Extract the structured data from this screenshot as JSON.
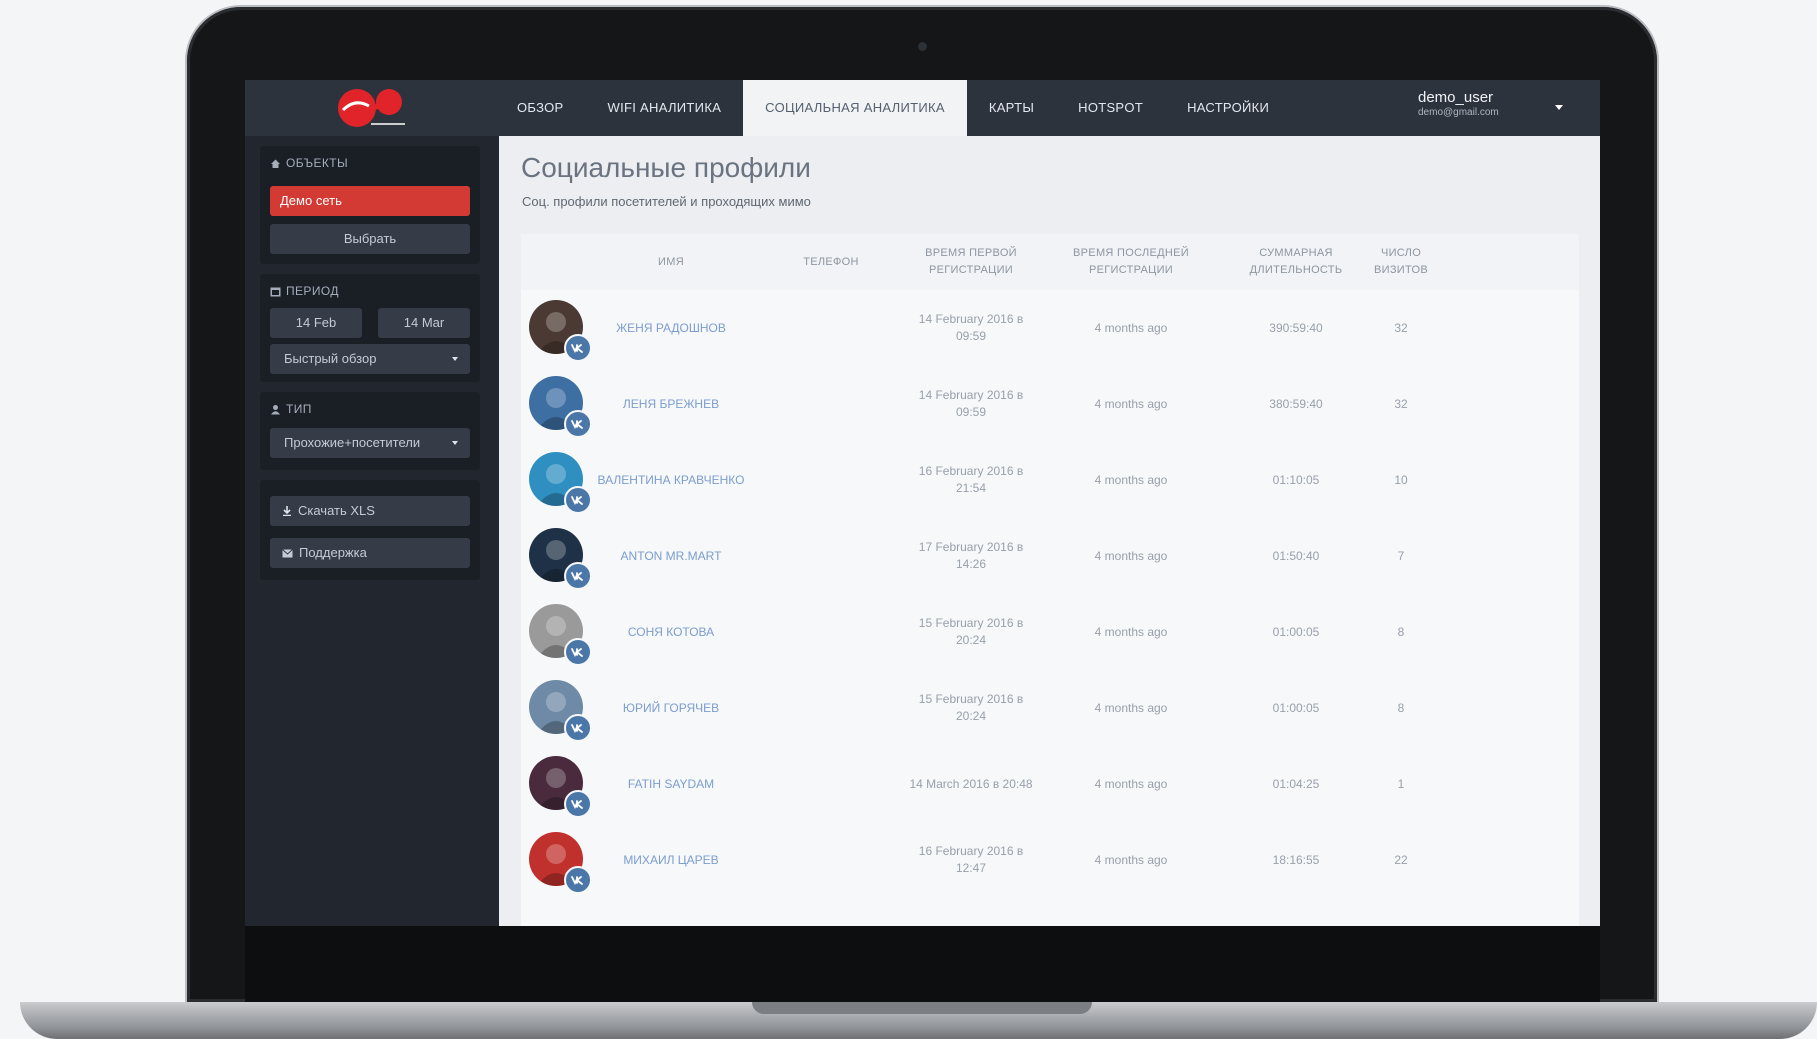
{
  "app": {
    "logo_alt": "Virgin connect"
  },
  "nav": {
    "tabs": [
      {
        "label": "ОБЗОР"
      },
      {
        "label": "WIFI АНАЛИТИКА"
      },
      {
        "label": "СОЦИАЛЬНАЯ АНАЛИТИКА",
        "active": true
      },
      {
        "label": "КАРТЫ"
      },
      {
        "label": "HOTSPOT"
      },
      {
        "label": "НАСТРОЙКИ"
      }
    ]
  },
  "user": {
    "name": "demo_user",
    "email": "demo@gmail.com"
  },
  "sidebar": {
    "objects": {
      "title": "ОБЪЕКТЫ",
      "network_button": "Демо сеть",
      "select_button": "Выбрать"
    },
    "period": {
      "title": "ПЕРИОД",
      "from": "14 Feb",
      "to": "14 Mar",
      "quick_view": "Быстрый обзор"
    },
    "type": {
      "title": "ТИП",
      "value": "Прохожие+посетители"
    },
    "actions": {
      "download": "Скачать XLS",
      "support": "Поддержка"
    }
  },
  "page": {
    "title": "Социальные профили",
    "subtitle": "Соц. профили посетителей и проходящих мимо"
  },
  "table": {
    "headers": {
      "name": "ИМЯ",
      "phone": "ТЕЛЕФОН",
      "first_reg": [
        "ВРЕМЯ ПЕРВОЙ",
        "РЕГИСТРАЦИИ"
      ],
      "last_reg": [
        "ВРЕМЯ ПОСЛЕДНЕЙ",
        "РЕГИСТРАЦИИ"
      ],
      "duration": [
        "СУММАРНАЯ",
        "ДЛИТЕЛЬНОСТЬ"
      ],
      "visits": [
        "ЧИСЛО",
        "ВИЗИТОВ"
      ]
    },
    "rows": [
      {
        "name": "ЖЕНЯ РАДОШНОВ",
        "phone": "",
        "first_reg": [
          "14 February 2016 в",
          "09:59"
        ],
        "last_reg": "4 months ago",
        "duration": "390:59:40",
        "visits": "32",
        "avatar_color": "#4b3a33"
      },
      {
        "name": "ЛЕНЯ БРЕЖНЕВ",
        "phone": "",
        "first_reg": [
          "14 February 2016 в",
          "09:59"
        ],
        "last_reg": "4 months ago",
        "duration": "380:59:40",
        "visits": "32",
        "avatar_color": "#3d6fa3"
      },
      {
        "name": "ВАЛЕНТИНА КРАВЧЕНКО",
        "phone": "",
        "first_reg": [
          "16 February 2016 в",
          "21:54"
        ],
        "last_reg": "4 months ago",
        "duration": "01:10:05",
        "visits": "10",
        "avatar_color": "#2f8fc0"
      },
      {
        "name": "ANTON MR.MART",
        "phone": "",
        "first_reg": [
          "17 February 2016 в",
          "14:26"
        ],
        "last_reg": "4 months ago",
        "duration": "01:50:40",
        "visits": "7",
        "avatar_color": "#1f3146"
      },
      {
        "name": "СОНЯ КОТОВА",
        "phone": "",
        "first_reg": [
          "15 February 2016 в",
          "20:24"
        ],
        "last_reg": "4 months ago",
        "duration": "01:00:05",
        "visits": "8",
        "avatar_color": "#9a9a9a"
      },
      {
        "name": "ЮРИЙ ГОРЯЧЕВ",
        "phone": "",
        "first_reg": [
          "15 February 2016 в",
          "20:24"
        ],
        "last_reg": "4 months ago",
        "duration": "01:00:05",
        "visits": "8",
        "avatar_color": "#6e8aa6"
      },
      {
        "name": "FATIH SAYDAM",
        "phone": "",
        "first_reg": [
          "14 March 2016 в 20:48"
        ],
        "last_reg": "4 months ago",
        "duration": "01:04:25",
        "visits": "1",
        "avatar_color": "#4a2b3d"
      },
      {
        "name": "МИХАИЛ ЦАРЕВ",
        "phone": "",
        "first_reg": [
          "16 February 2016 в",
          "12:47"
        ],
        "last_reg": "4 months ago",
        "duration": "18:16:55",
        "visits": "22",
        "avatar_color": "#c0302c"
      }
    ]
  },
  "colors": {
    "accent_red": "#d33a33",
    "vk_blue": "#4a76a8",
    "link_blue": "#7b9dcf"
  }
}
